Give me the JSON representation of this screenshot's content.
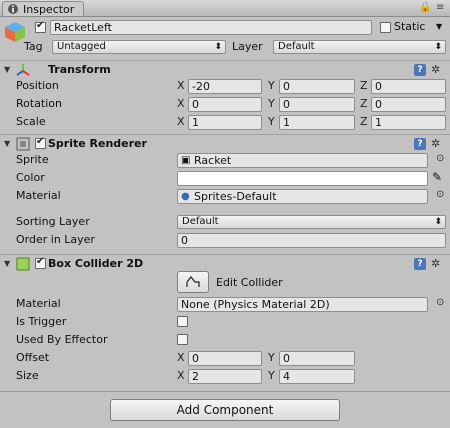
{
  "window": {
    "tab_title": "Inspector"
  },
  "header": {
    "active": true,
    "name": "RacketLeft",
    "static_label": "Static",
    "tag_label": "Tag",
    "tag_value": "Untagged",
    "layer_label": "Layer",
    "layer_value": "Default"
  },
  "transform": {
    "title": "Transform",
    "position": {
      "label": "Position",
      "x": "-20",
      "y": "0",
      "z": "0"
    },
    "rotation": {
      "label": "Rotation",
      "x": "0",
      "y": "0",
      "z": "0"
    },
    "scale": {
      "label": "Scale",
      "x": "1",
      "y": "1",
      "z": "1"
    },
    "axis_x": "X",
    "axis_y": "Y",
    "axis_z": "Z"
  },
  "sprite_renderer": {
    "title": "Sprite Renderer",
    "enabled": true,
    "sprite_label": "Sprite",
    "sprite_value": "Racket",
    "color_label": "Color",
    "color_value": "#ffffff",
    "material_label": "Material",
    "material_value": "Sprites-Default",
    "sorting_layer_label": "Sorting Layer",
    "sorting_layer_value": "Default",
    "order_label": "Order in Layer",
    "order_value": "0"
  },
  "box_collider": {
    "title": "Box Collider 2D",
    "enabled": true,
    "edit_collider_label": "Edit Collider",
    "material_label": "Material",
    "material_value": "None (Physics Material 2D)",
    "is_trigger_label": "Is Trigger",
    "is_trigger": false,
    "used_by_effector_label": "Used By Effector",
    "used_by_effector": false,
    "offset_label": "Offset",
    "offset_x": "0",
    "offset_y": "0",
    "size_label": "Size",
    "size_x": "2",
    "size_y": "4",
    "axis_x": "X",
    "axis_y": "Y"
  },
  "footer": {
    "add_component_label": "Add Component"
  },
  "icons": {
    "tab": "info-icon",
    "lock": "lock-icon",
    "menu": "menu-icon",
    "gameobject": "cube-icon",
    "transform": "transform-icon",
    "help": "help-icon",
    "gear": "gear-icon",
    "picker": "eyedropper-icon"
  }
}
